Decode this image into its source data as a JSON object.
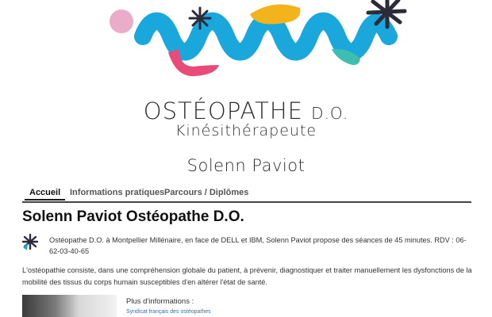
{
  "header": {
    "title_main": "OSTÉOPATHE",
    "title_suffix": "D.O.",
    "subtitle": "Kinésithérapeute",
    "name": "Solenn Paviot",
    "logo_colors": [
      "#1aa7dc",
      "#e84a7a",
      "#f3b31c",
      "#3fbdb0",
      "#2b2b3a",
      "#e7a3c3"
    ]
  },
  "nav": {
    "tabs": [
      {
        "label": "Accueil",
        "active": true
      },
      {
        "label": "Informations pratiques",
        "active": false
      },
      {
        "label": "Parcours / Diplômes",
        "active": false
      }
    ]
  },
  "main": {
    "title": "Solenn Paviot Ostéopathe D.O.",
    "intro": "Ostéopathe D.O. à Montpellier Millénaire, en face de DELL et IBM, Solenn Paviot propose des séances de 45 minutes. RDV : 06-62-03-40-65",
    "paragraph": "L'ostéopathie consiste, dans une compréhension globale du patient, à prévenir, diagnostiquer et traiter manuellement les dysfonctions de la mobilité des tissus du corps humain susceptibles d'en altérer l'état de santé.",
    "more_label": "Plus d'informations :",
    "more_link": "Syndicat français des ostéopathes"
  }
}
